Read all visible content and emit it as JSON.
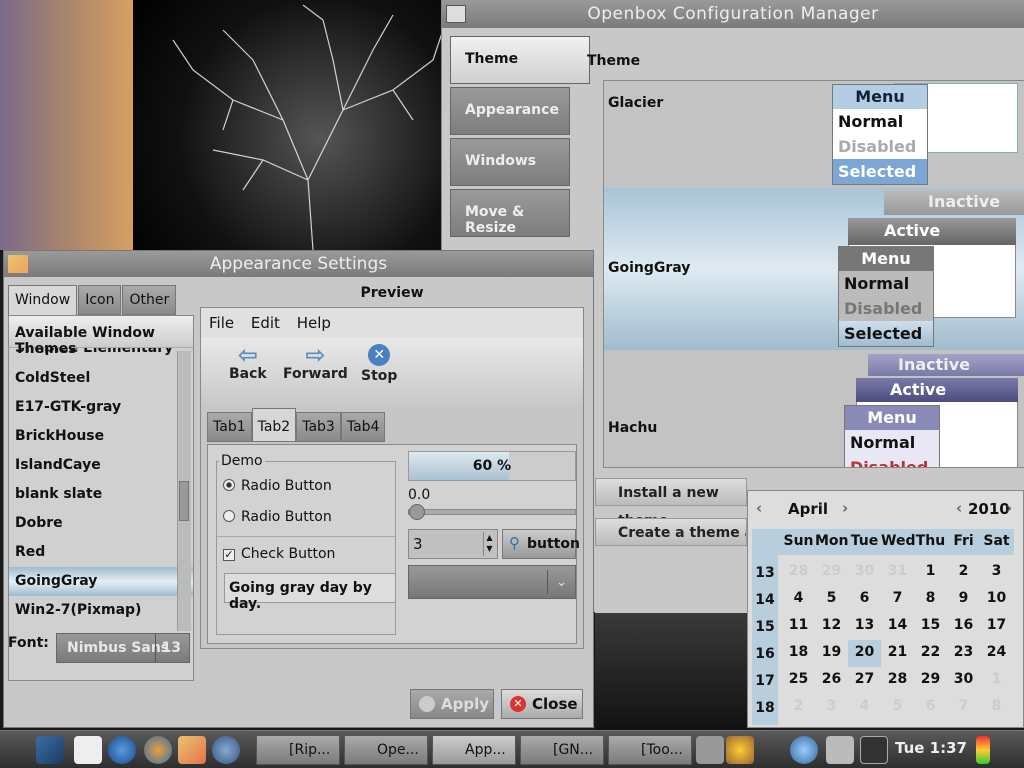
{
  "openbox": {
    "title": "Openbox Configuration Manager",
    "tabs": [
      "Theme",
      "Appearance",
      "Windows",
      "Move & Resize"
    ],
    "section_label": "Theme",
    "themes": [
      {
        "name": "Glacier",
        "menu": {
          "header": "Menu",
          "normal": "Normal",
          "disabled": "Disabled",
          "selected": "Selected"
        }
      },
      {
        "name": "GoingGray",
        "inactive": "Inactive",
        "active": "Active",
        "menu": {
          "header": "Menu",
          "normal": "Normal",
          "disabled": "Disabled",
          "selected": "Selected"
        }
      },
      {
        "name": "Hachu",
        "inactive": "Inactive",
        "active": "Active",
        "menu": {
          "header": "Menu",
          "normal": "Normal",
          "disabled": "Disabled"
        }
      }
    ],
    "install_button": "Install a new theme...",
    "create_button": "Create a theme archive..."
  },
  "appearance": {
    "title": "Appearance Settings",
    "tabs": [
      "Window",
      "Icon",
      "Other"
    ],
    "list_header": "Available Window Themes",
    "list_partial": "Simplee Elementary",
    "themes": [
      "ColdSteel",
      "E17-GTK-gray",
      "BrickHouse",
      "IslandCaye",
      "blank slate",
      "Dobre",
      "Red",
      "GoingGray",
      "Win2-7(Pixmap)"
    ],
    "selected_theme": "GoingGray",
    "font_label": "Font:",
    "font_name": "Nimbus Sans",
    "font_size": "13",
    "preview_label": "Preview",
    "apply_label": "Apply",
    "close_label": "Close"
  },
  "preview": {
    "menu": [
      "File",
      "Edit",
      "Help"
    ],
    "toolbar": {
      "back": "Back",
      "forward": "Forward",
      "stop": "Stop"
    },
    "tabs": [
      "Tab1",
      "Tab2",
      "Tab3",
      "Tab4"
    ],
    "demo_label": "Demo",
    "radio1": "Radio Button",
    "radio2": "Radio Button",
    "check": "Check Button",
    "entry_text": "Going gray day by day.",
    "progress_text": "60 %",
    "progress": 0.6,
    "slider_value": "0.0",
    "spin_value": "3",
    "button_label": "button"
  },
  "calendar": {
    "month": "April",
    "year": "2010",
    "days": [
      "Sun",
      "Mon",
      "Tue",
      "Wed",
      "Thu",
      "Fri",
      "Sat"
    ],
    "weeks": [
      "13",
      "14",
      "15",
      "16",
      "17",
      "18"
    ],
    "rows": [
      [
        "28",
        "29",
        "30",
        "31",
        "1",
        "2",
        "3"
      ],
      [
        "4",
        "5",
        "6",
        "7",
        "8",
        "9",
        "10"
      ],
      [
        "11",
        "12",
        "13",
        "14",
        "15",
        "16",
        "17"
      ],
      [
        "18",
        "19",
        "20",
        "21",
        "22",
        "23",
        "24"
      ],
      [
        "25",
        "26",
        "27",
        "28",
        "29",
        "30",
        "1"
      ],
      [
        "2",
        "3",
        "4",
        "5",
        "6",
        "7",
        "8"
      ]
    ],
    "today": "20"
  },
  "taskbar": {
    "tasks": [
      "[Rip...",
      "Ope...",
      "App...",
      "[GN...",
      "[Too..."
    ],
    "clock": "Tue  1:37"
  }
}
